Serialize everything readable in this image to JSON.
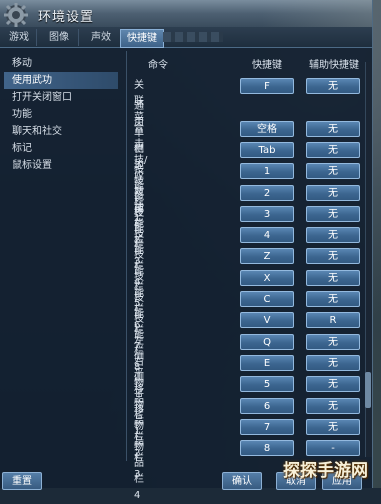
{
  "window": {
    "title": "环境设置"
  },
  "tabs": [
    {
      "label": "游戏",
      "active": false
    },
    {
      "label": "图像",
      "active": false
    },
    {
      "label": "声效",
      "active": false
    },
    {
      "label": "快捷键",
      "active": true
    }
  ],
  "sidebar": {
    "items": [
      {
        "label": "移动",
        "active": false
      },
      {
        "label": "使用武功",
        "active": true
      },
      {
        "label": "打开关闭窗口",
        "active": false
      },
      {
        "label": "功能",
        "active": false
      },
      {
        "label": "聊天和社交",
        "active": false
      },
      {
        "label": "标记",
        "active": false
      },
      {
        "label": "鼠标设置",
        "active": false
      }
    ]
  },
  "table": {
    "headers": {
      "command": "命令",
      "hotkey": "快捷键",
      "alt_hotkey": "辅助快捷键"
    },
    "rows": [
      {
        "label": "关联菜单栏 3",
        "key": "F",
        "alt": "无"
      },
      {
        "label": "通用",
        "key": "",
        "alt": ""
      },
      {
        "label": "合击技/应对技能栏",
        "key": "空格",
        "alt": "无"
      },
      {
        "label": "侧边技能栏",
        "key": "Tab",
        "alt": "无"
      },
      {
        "label": "技能栏 1",
        "key": "1",
        "alt": "无"
      },
      {
        "label": "技能栏 2",
        "key": "2",
        "alt": "无"
      },
      {
        "label": "技能栏 3",
        "key": "3",
        "alt": "无"
      },
      {
        "label": "技能栏 4",
        "key": "4",
        "alt": "无"
      },
      {
        "label": "技能栏 5",
        "key": "Z",
        "alt": "无"
      },
      {
        "label": "技能栏 6",
        "key": "X",
        "alt": "无"
      },
      {
        "label": "技能栏 7",
        "key": "C",
        "alt": "无"
      },
      {
        "label": "技能栏 8",
        "key": "V",
        "alt": "R"
      },
      {
        "label": "左侧平移",
        "key": "Q",
        "alt": "无"
      },
      {
        "label": "右侧平移",
        "key": "E",
        "alt": "无"
      },
      {
        "label": "物品栏 1",
        "key": "5",
        "alt": "无"
      },
      {
        "label": "物品栏 2",
        "key": "6",
        "alt": "无"
      },
      {
        "label": "物品栏 3",
        "key": "7",
        "alt": "无"
      },
      {
        "label": "物品栏 4",
        "key": "8",
        "alt": "-"
      }
    ]
  },
  "footer": {
    "reset": "重置",
    "confirm": "确认",
    "cancel": "取消",
    "apply": "应用"
  },
  "watermark": "探探手游网",
  "colors": {
    "accent": "#3c6690",
    "panel": "#122030",
    "active_tab": "#5f86ad"
  }
}
